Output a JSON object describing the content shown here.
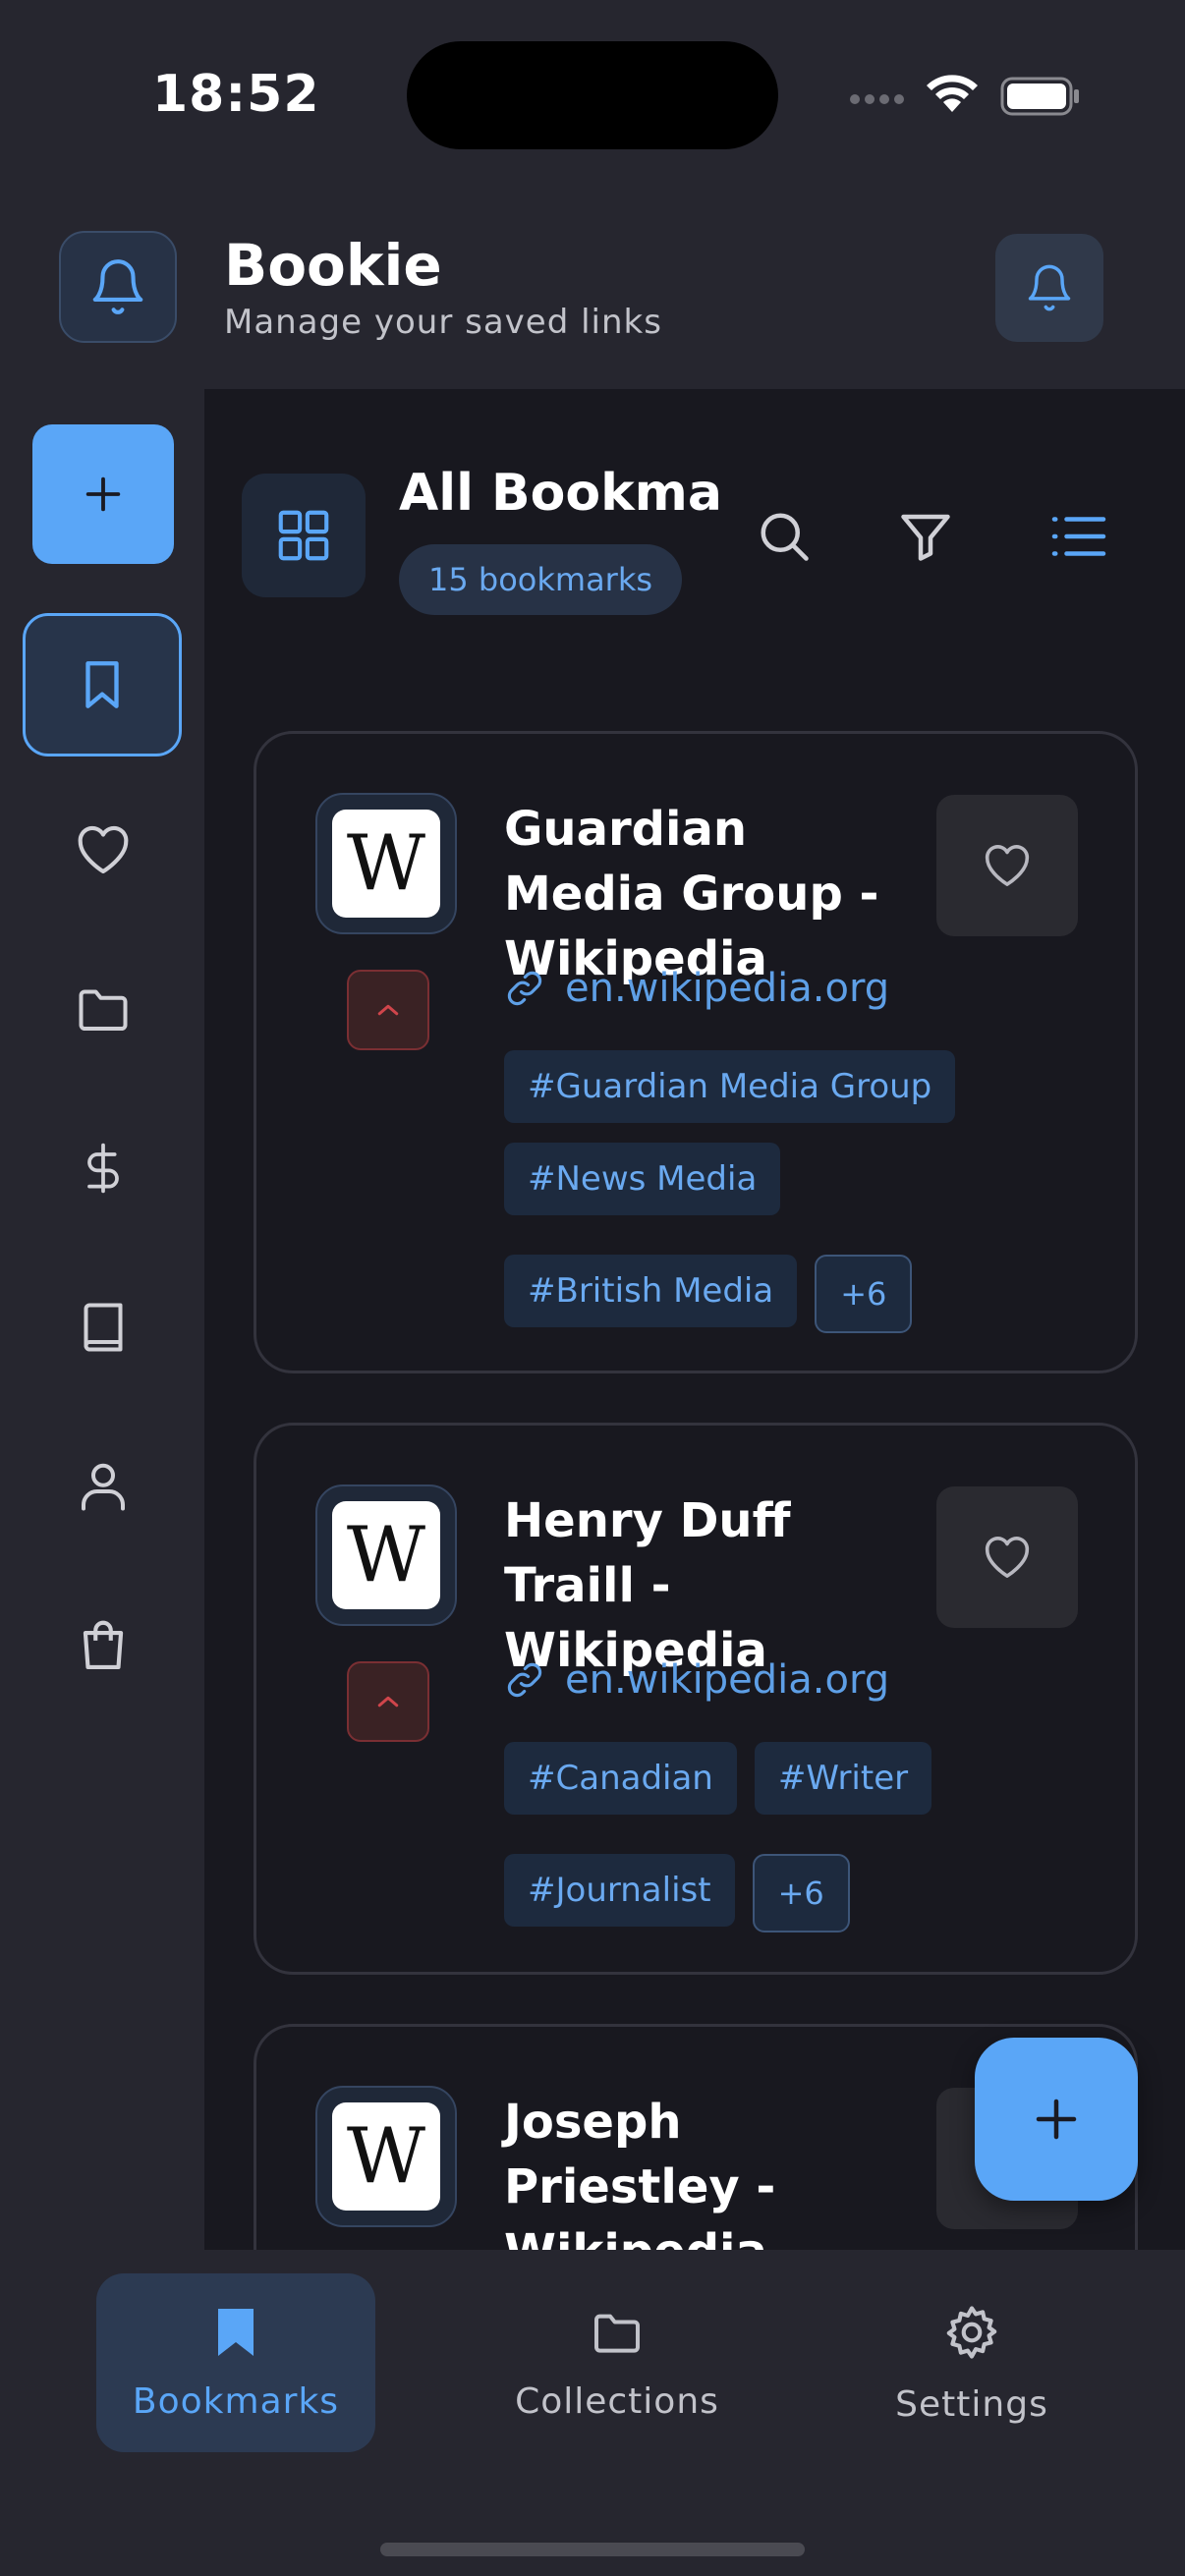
{
  "status_bar": {
    "time": "18:52"
  },
  "header": {
    "title": "Bookie",
    "subtitle": "Manage your saved links"
  },
  "sidebar": {
    "items": [
      {
        "icon": "plus-icon"
      },
      {
        "icon": "bookmark-icon",
        "active": true
      },
      {
        "icon": "heart-icon"
      },
      {
        "icon": "folder-icon"
      },
      {
        "icon": "dollar-icon"
      },
      {
        "icon": "book-icon"
      },
      {
        "icon": "user-icon"
      },
      {
        "icon": "shopping-bag-icon"
      }
    ]
  },
  "main": {
    "title": "All Bookma…",
    "count": "15 bookmarks"
  },
  "bookmarks": [
    {
      "title": "Guardian Media Group - Wikipedia",
      "url": "en.wikipedia.org",
      "favicon": "W",
      "tags": [
        "#Guardian Media Group",
        "#News Media",
        "#British Media"
      ],
      "more": "+6"
    },
    {
      "title": "Henry Duff Traill - Wikipedia",
      "url": "en.wikipedia.org",
      "favicon": "W",
      "tags": [
        "#Canadian",
        "#Writer",
        "#Journalist"
      ],
      "more": "+6"
    },
    {
      "title": "Joseph Priestley - Wikipedia",
      "favicon": "W"
    }
  ],
  "bottom_nav": {
    "bookmarks": "Bookmarks",
    "collections": "Collections",
    "settings": "Settings"
  },
  "colors": {
    "accent": "#5aa6f7",
    "background": "#18181f",
    "surface": "#26262f",
    "danger": "#d0454b"
  }
}
